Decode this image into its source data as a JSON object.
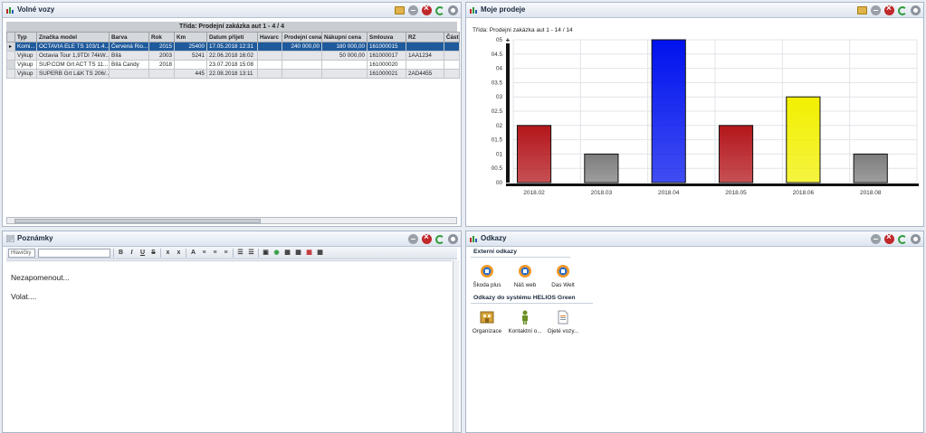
{
  "vozy": {
    "title": "Volné vozy",
    "group": "Třída: Prodejní zakázka aut  1 - 4 / 4",
    "columns": [
      "Typ",
      "Značka model",
      "Barva",
      "Rok",
      "Km",
      "Datum přijetí",
      "Havarc",
      "Prodejní cena",
      "Nákupní cena",
      "Smlouva",
      "RZ",
      "Částka"
    ],
    "rows": [
      [
        "Komi...",
        "OCTAVIA ELE TS 103/1.4...",
        "Červená Rio...",
        "2015",
        "25400",
        "17.05.2018 12:31",
        "",
        "240 000,00",
        "180 000,00",
        "161000015",
        "",
        ""
      ],
      [
        "Výkup",
        "Octavia Tour 1,9TDI 74kW...",
        "Bílá",
        "2003",
        "5241",
        "22.06.2018 16:02",
        "",
        "",
        "50 000,00",
        "161000017",
        "1AA1234",
        ""
      ],
      [
        "Výkup",
        "SUP.COM Grt ACT TS 11...",
        "Bílá Candy",
        "2018",
        "",
        "23.07.2018 15:08",
        "",
        "",
        "",
        "161000020",
        "",
        ""
      ],
      [
        "Výkup",
        "SUPERB Grt L&K TS 206/...",
        "",
        "",
        "445",
        "22.08.2018 13:11",
        "",
        "",
        "",
        "161000021",
        "2AD4455",
        ""
      ]
    ]
  },
  "prodeje": {
    "title": "Moje prodeje",
    "subtitle": "Třída: Prodejní zakázka aut  1 - 14 / 14"
  },
  "chart_data": {
    "type": "bar",
    "title": "",
    "categories": [
      "2018.02",
      "2018.03",
      "2018.04",
      "2018.05",
      "2018.06",
      "2018.08"
    ],
    "values": [
      0.2,
      0.1,
      0.5,
      0.2,
      0.3,
      0.1
    ],
    "colors": [
      "#b3161b",
      "#7d7d7d",
      "#0012ee",
      "#b3161b",
      "#f2f000",
      "#7d7d7d"
    ],
    "y_ticks": [
      "00",
      "00.5",
      "01",
      "01.5",
      "02",
      "02.5",
      "03",
      "03.5",
      "04",
      "04.5",
      "05"
    ],
    "ylim": [
      0,
      0.5
    ],
    "grid": true
  },
  "poznamky": {
    "title": "Poznámky",
    "heading_select": "Hlavičky",
    "lines": [
      "Nezapomenout...",
      "Volat...."
    ]
  },
  "odkazy": {
    "title": "Odkazy",
    "external_title": "Externí odkazy",
    "external": [
      "Škoda plus",
      "Náš web",
      "Das Welt"
    ],
    "helios_title": "Odkazy do systému HELIOS Green",
    "helios": [
      "Organizace",
      "Kontaktní  o...",
      "Ojeté vozy..."
    ]
  }
}
